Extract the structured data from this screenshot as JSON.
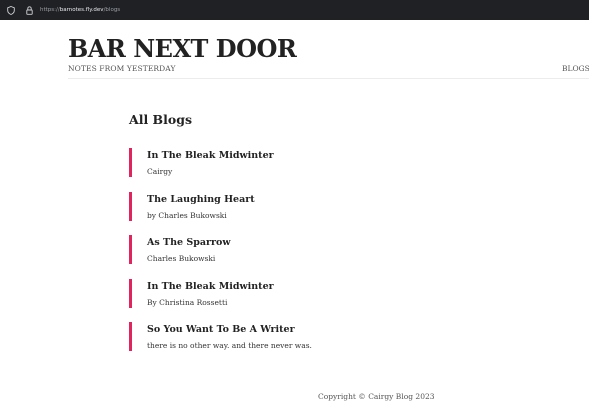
{
  "browser": {
    "url_prefix": "https://",
    "url_host": "barnotes.fly.dev",
    "url_path": "/blogs"
  },
  "site": {
    "title": "BAR NEXT DOOR",
    "subtitle": "NOTES FROM YESTERDAY",
    "nav_blogs": "BLOGS"
  },
  "main": {
    "heading": "All Blogs",
    "blogs": [
      {
        "title": "In The Bleak Midwinter",
        "description": "Cairgy"
      },
      {
        "title": "The Laughing Heart",
        "description": "by Charles Bukowski"
      },
      {
        "title": "As The Sparrow",
        "description": "Charles Bukowski"
      },
      {
        "title": "In The Bleak Midwinter",
        "description": "By Christina Rossetti"
      },
      {
        "title": "So You Want To Be A Writer",
        "description": "there is no other way. and there never was."
      }
    ]
  },
  "footer": {
    "copyright": "Copyright © Cairgy Blog 2023"
  },
  "colors": {
    "accent": "#e0245e",
    "browser_bar": "#202124"
  }
}
